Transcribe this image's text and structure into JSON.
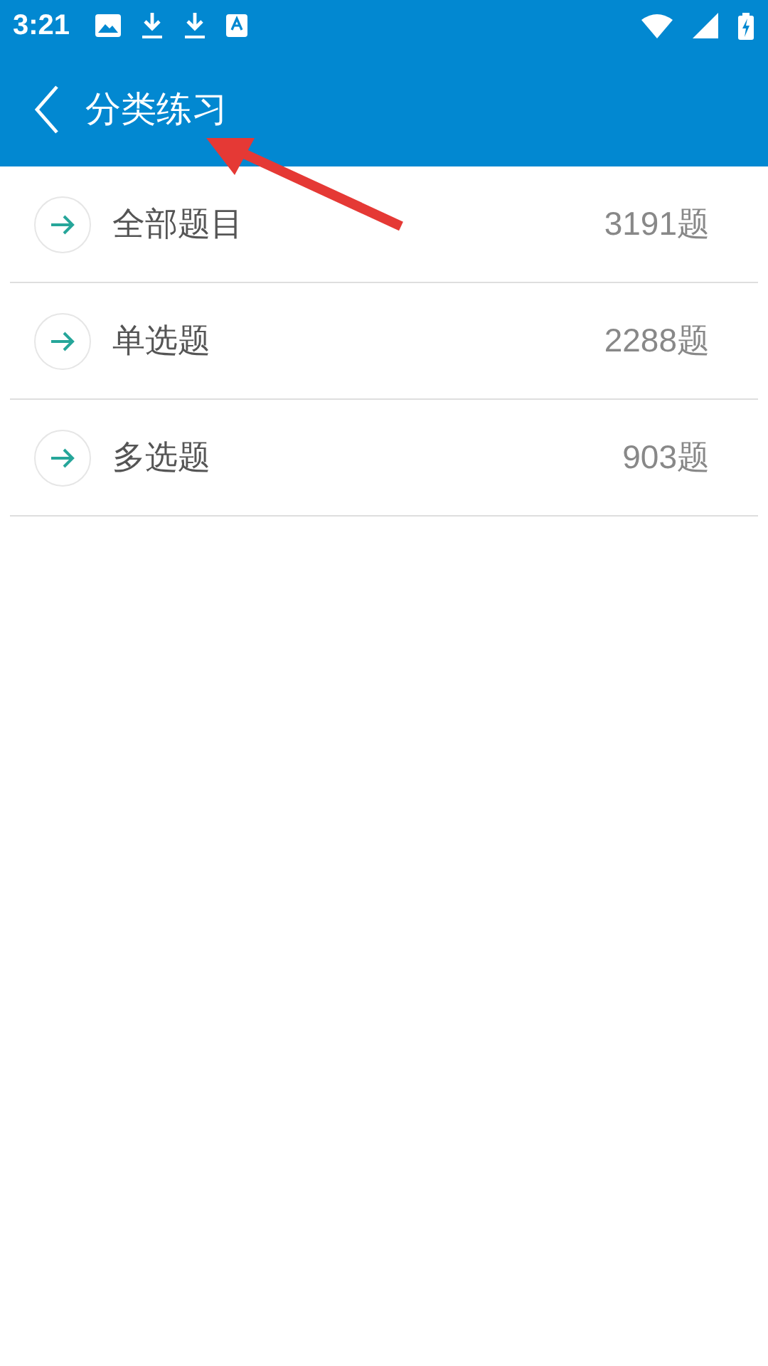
{
  "status_bar": {
    "time": "3:21"
  },
  "app_bar": {
    "title": "分类练习"
  },
  "categories": [
    {
      "label": "全部题目",
      "count": "3191题"
    },
    {
      "label": "单选题",
      "count": "2288题"
    },
    {
      "label": "多选题",
      "count": "903题"
    }
  ]
}
